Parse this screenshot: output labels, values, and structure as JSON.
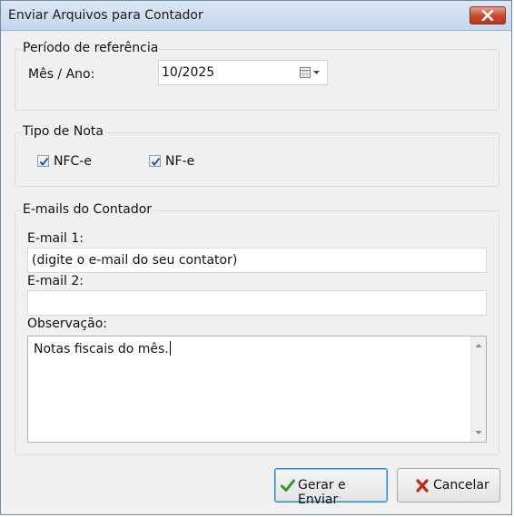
{
  "window": {
    "title": "Enviar Arquivos para Contador"
  },
  "periodo": {
    "legend": "Período de referência",
    "mes_ano_label": "Mês / Ano:",
    "mes_ano_value": "10/2025"
  },
  "tipo_nota": {
    "legend": "Tipo de Nota",
    "nfce_label": "NFC-e",
    "nfce_checked": true,
    "nfe_label": "NF-e",
    "nfe_checked": true
  },
  "emails": {
    "legend": "E-mails do Contador",
    "email1_label": "E-mail 1:",
    "email1_value": "(digite o e-mail do seu contator)",
    "email2_label": "E-mail 2:",
    "email2_value": "",
    "observacao_label": "Observação:",
    "observacao_value": "Notas fiscais do mês."
  },
  "buttons": {
    "send_label": "Gerar e Enviar",
    "cancel_label": "Cancelar"
  },
  "icons": {
    "close": "close-icon",
    "calendar": "calendar-icon",
    "send": "checkmark-icon",
    "cancel": "x-icon"
  },
  "colors": {
    "send_icon": "#2e9b2e",
    "cancel_icon": "#c0281c",
    "close_button": "#c8472f"
  }
}
